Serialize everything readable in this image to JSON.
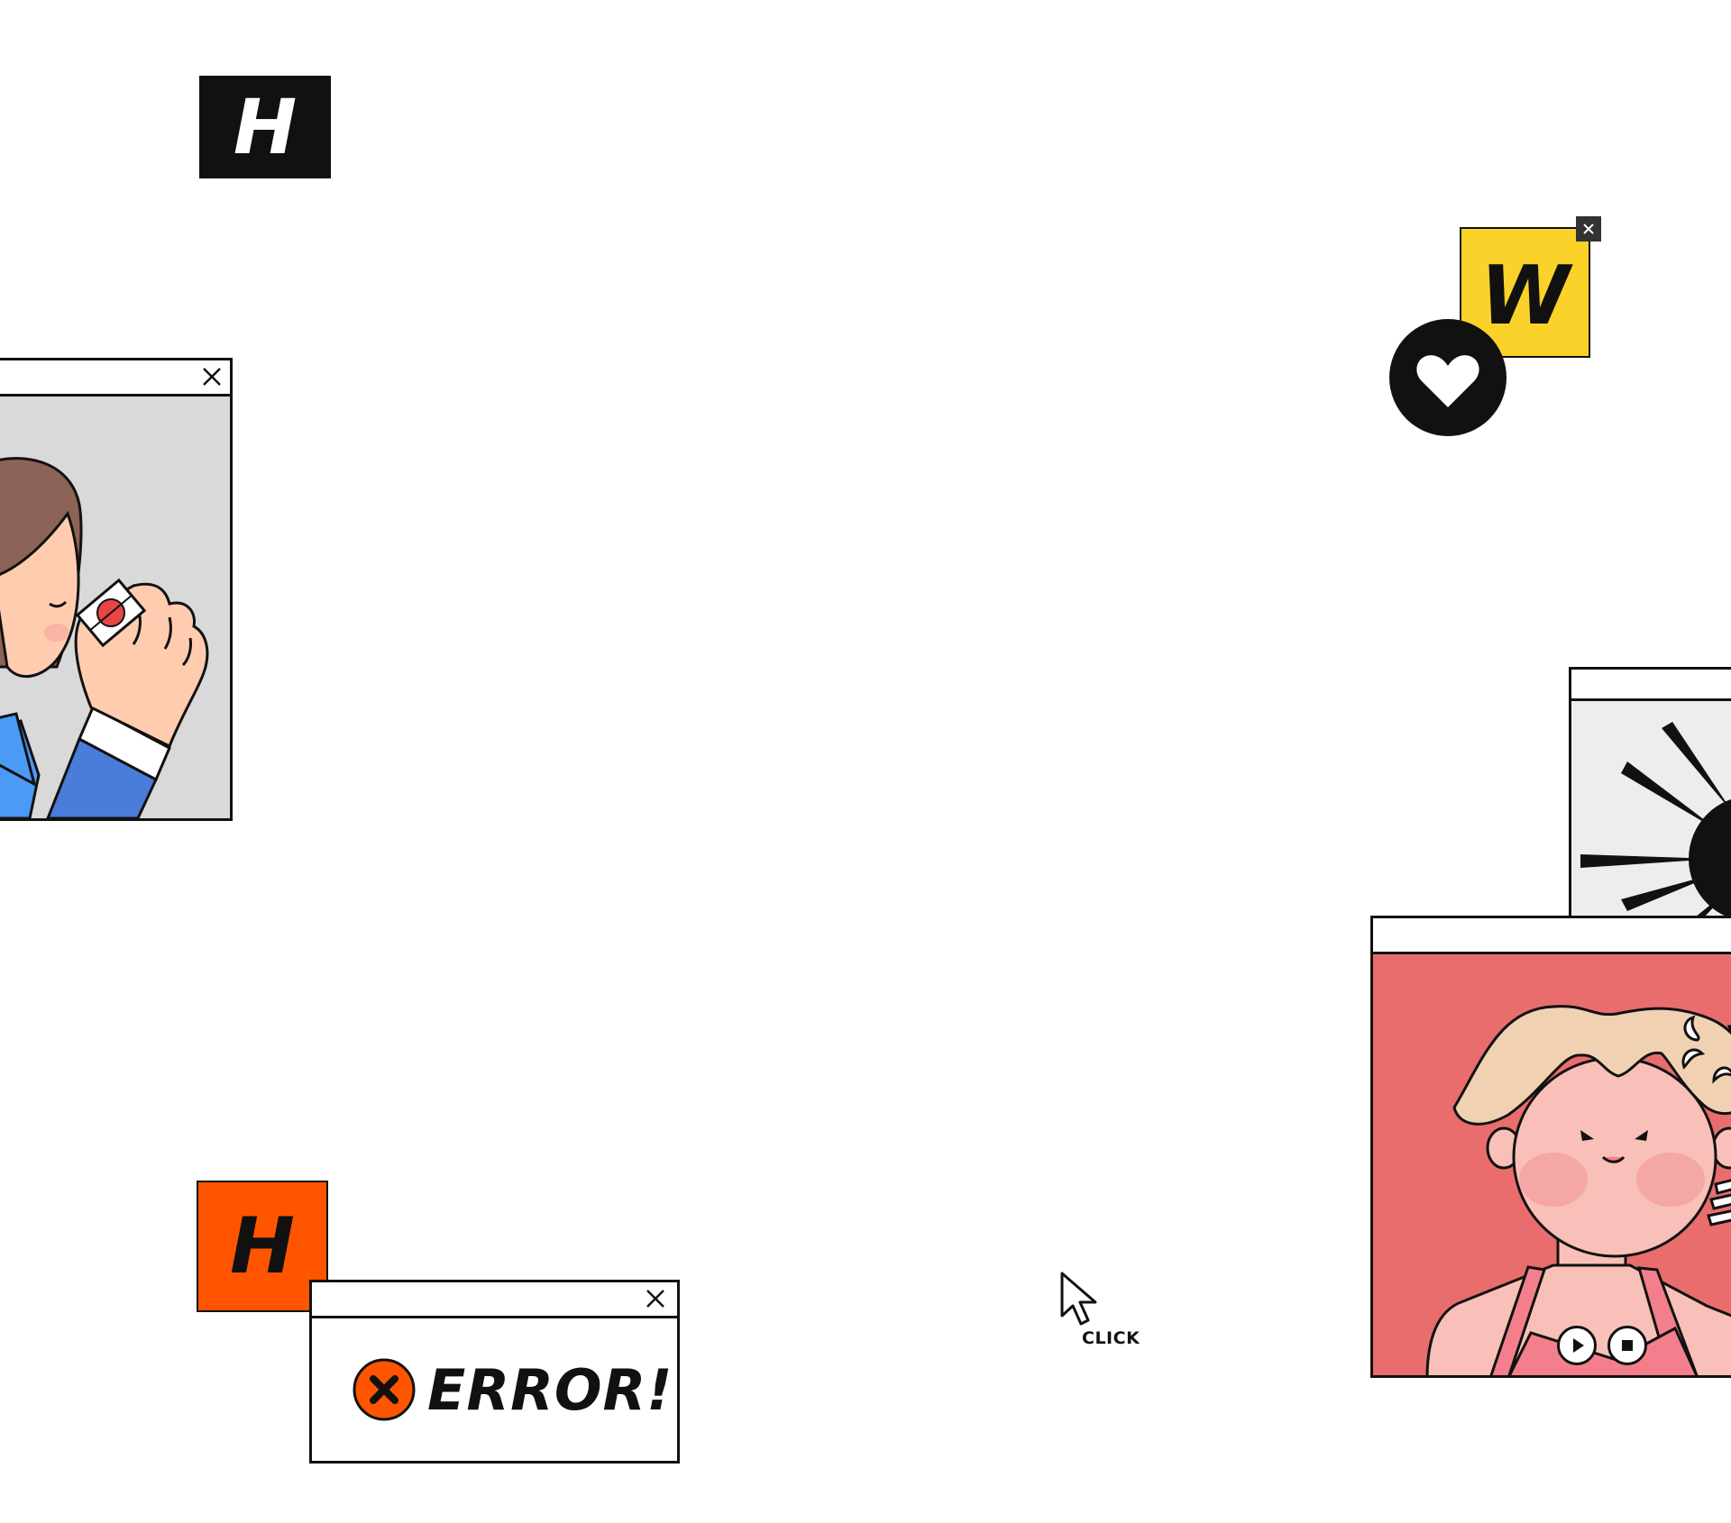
{
  "badges": {
    "h_top": "H",
    "w": "W",
    "h_bottom": "H"
  },
  "error_dialog": {
    "message": "ERROR!"
  },
  "cursor": {
    "label": "CLICK"
  },
  "icons": {
    "close": "close-icon",
    "heart": "heart-icon",
    "error": "error-x-icon",
    "pointer": "mouse-pointer-icon",
    "play": "play-icon",
    "stop": "stop-icon"
  },
  "colors": {
    "black": "#111111",
    "yellow": "#FAD22A",
    "orange": "#FF5500",
    "gray_panel": "#D9D9D9",
    "light_panel": "#EDEDED",
    "pink_bg": "#E96D6D",
    "skin": "#FFCCB0",
    "suit_blue": "#4A7CD9",
    "hair_brown": "#8C6356",
    "hair_blonde": "#F0D2B2"
  }
}
